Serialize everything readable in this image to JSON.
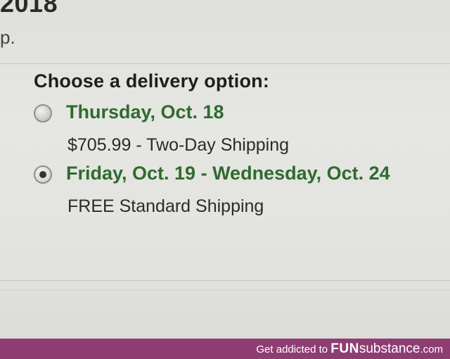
{
  "header": {
    "year_fragment": "2018",
    "text_fragment": "p."
  },
  "delivery": {
    "heading": "Choose a delivery option:",
    "options": [
      {
        "date": "Thursday, Oct. 18",
        "detail": "$705.99 - Two-Day Shipping",
        "selected": false
      },
      {
        "date": "Friday, Oct. 19 - Wednesday, Oct. 24",
        "detail": "FREE Standard Shipping",
        "selected": true
      }
    ]
  },
  "watermark": {
    "prefix": "Get addicted to ",
    "brand_bold": "FUN",
    "brand_light": "substance",
    "suffix": ".com"
  },
  "colors": {
    "date_green": "#2f6b2f",
    "footer_bg": "#8e3d73"
  }
}
